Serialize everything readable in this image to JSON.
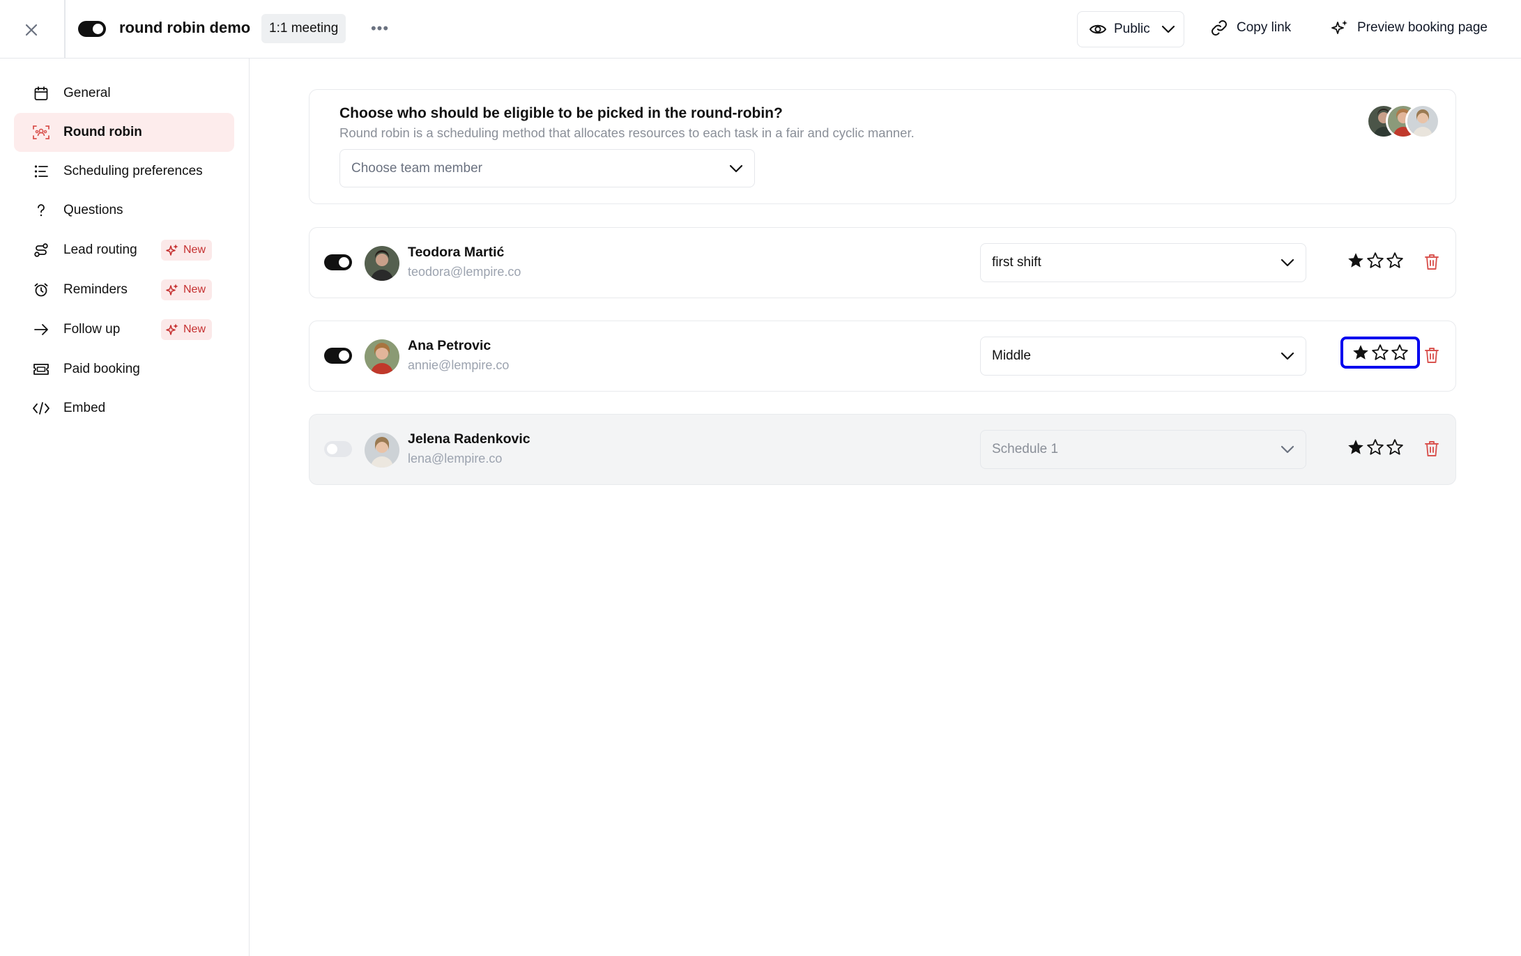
{
  "topbar": {
    "title": "round robin demo",
    "meeting_type": "1:1 meeting",
    "visibility": "Public",
    "copy_link": "Copy link",
    "preview": "Preview booking page"
  },
  "sidebar": {
    "items": [
      {
        "label": "General"
      },
      {
        "label": "Round robin"
      },
      {
        "label": "Scheduling preferences"
      },
      {
        "label": "Questions"
      },
      {
        "label": "Lead routing",
        "badge": "New"
      },
      {
        "label": "Reminders",
        "badge": "New"
      },
      {
        "label": "Follow up",
        "badge": "New"
      },
      {
        "label": "Paid booking"
      },
      {
        "label": "Embed"
      }
    ]
  },
  "round_robin": {
    "title": "Choose who should be eligible to be picked in the round-robin?",
    "subtitle": "Round robin is a scheduling method that allocates resources to each task in a fair and cyclic manner.",
    "select_placeholder": "Choose team member"
  },
  "members": [
    {
      "name": "Teodora Martić",
      "email": "teodora@lempire.co",
      "schedule": "first shift",
      "enabled": true,
      "rating": 1
    },
    {
      "name": "Ana Petrovic",
      "email": "annie@lempire.co",
      "schedule": "Middle",
      "enabled": true,
      "rating": 1
    },
    {
      "name": "Jelena Radenkovic",
      "email": "lena@lempire.co",
      "schedule": "Schedule 1",
      "enabled": false,
      "rating": 1
    }
  ],
  "colors": {
    "accent_bg": "#fdecec",
    "accent": "#c53030",
    "focus_ring": "#0000ee"
  }
}
